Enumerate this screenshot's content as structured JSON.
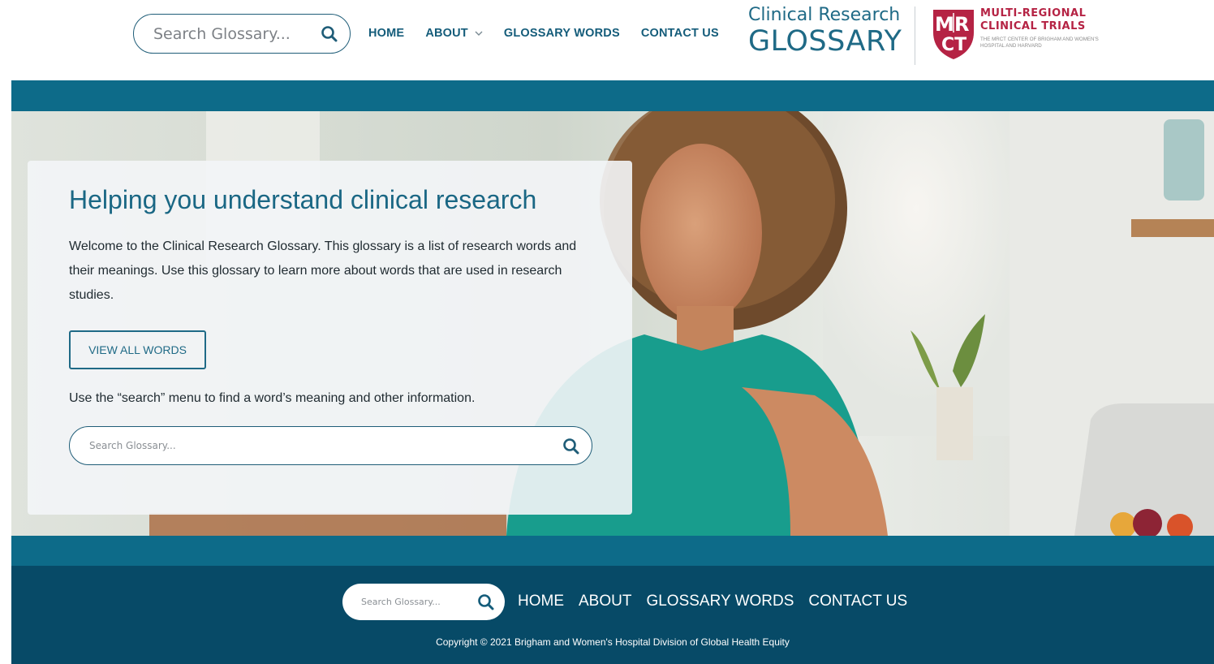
{
  "header": {
    "search_placeholder": "Search Glossary...",
    "nav": {
      "home": "HOME",
      "about": "ABOUT",
      "glossary_words": "GLOSSARY WORDS",
      "contact_us": "CONTACT US"
    },
    "brand": {
      "line1": "Clinical Research",
      "line2": "GLOSSARY"
    },
    "mrct": {
      "line1": "MULTI-REGIONAL",
      "line2": "CLINICAL TRIALS",
      "sub": "THE MRCT CENTER of BRIGHAM AND WOMEN'S HOSPITAL and HARVARD"
    }
  },
  "hero": {
    "title": "Helping you understand clinical research",
    "body": "Welcome to the Clinical Research Glossary. This glossary is a list of research words and their meanings. Use this glossary to learn more about words that are used in research studies.",
    "button": "VIEW ALL WORDS",
    "hint": "Use the “search” menu to find a word’s meaning and other information.",
    "search_placeholder": "Search Glossary..."
  },
  "footer": {
    "search_placeholder": "Search Glossary...",
    "nav": {
      "home": "HOME",
      "about": "ABOUT",
      "glossary_words": "GLOSSARY WORDS",
      "contact_us": "CONTACT US"
    },
    "copyright": "Copyright © 2021 Brigham and Women's Hospital Division of Global Health Equity"
  },
  "colors": {
    "brand_teal": "#1f6a86",
    "band_teal": "#0d6b89",
    "footer_navy": "#074a67",
    "mrct_red": "#b52344"
  },
  "icons": [
    "search-icon",
    "chevron-down-icon",
    "mrct-logo-icon"
  ]
}
